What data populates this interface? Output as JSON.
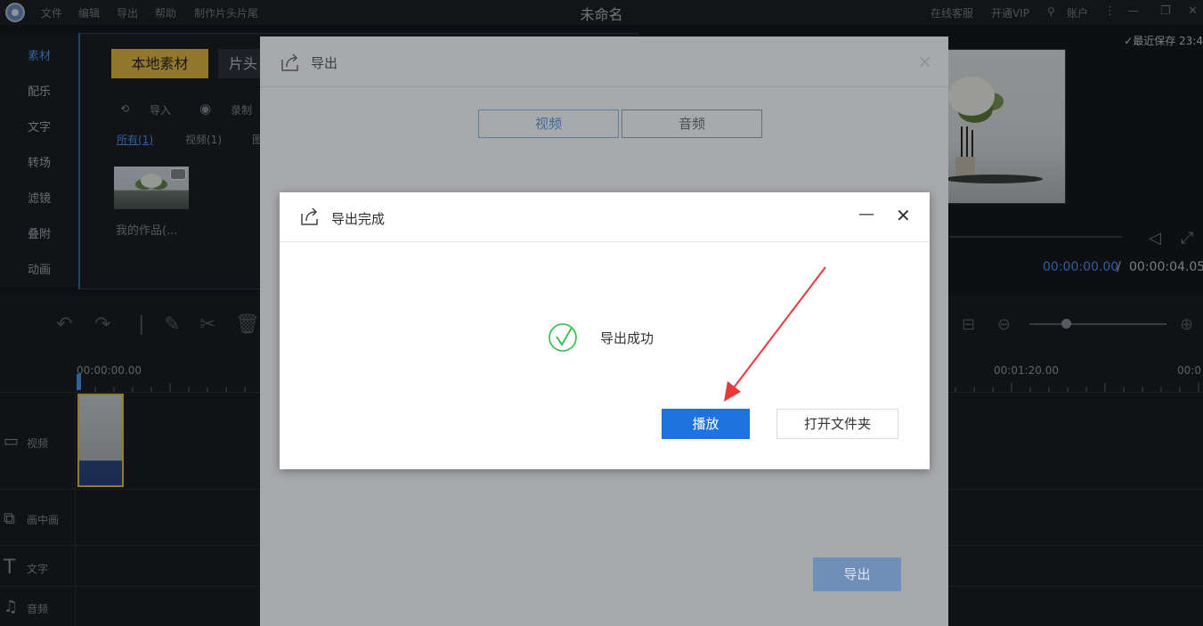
{
  "titlebar": {
    "menu": [
      "文件",
      "编辑",
      "导出",
      "帮助",
      "制作片头片尾"
    ],
    "title": "未命名",
    "right_links": [
      "在线客服",
      "开通VIP",
      "账户"
    ]
  },
  "sidebar": {
    "items": [
      "素材",
      "配乐",
      "文字",
      "转场",
      "滤镜",
      "叠附",
      "动画"
    ],
    "active_index": 0
  },
  "media": {
    "tab_local": "本地素材",
    "tab_clip": "片头",
    "import_label": "导入",
    "record_label": "录制",
    "filter_all": "所有(1)",
    "filter_video": "视频(1)",
    "filter_more": "图",
    "item_name": "我的作品(..."
  },
  "preview": {
    "save_status": "最近保存 23:4",
    "current_time": "00:00:00.00",
    "separator": "/",
    "total_time": "00:00:04.05"
  },
  "timeline": {
    "ruler_labels": [
      "00:00:00.00",
      "00:01:20.00",
      "00:0"
    ],
    "tracks": [
      "视频",
      "画中画",
      "文字",
      "音频"
    ]
  },
  "export_dialog": {
    "title": "导出",
    "close": "×",
    "tab_video": "视频",
    "tab_audio": "音频",
    "export_button": "导出"
  },
  "complete_dialog": {
    "title": "导出完成",
    "minimize": "—",
    "close": "✕",
    "message": "导出成功",
    "play_button": "播放",
    "open_folder_button": "打开文件夹"
  },
  "colors": {
    "accent_blue": "#1f73df",
    "success_green": "#2dbd4a",
    "arrow_red": "#e83a3a",
    "tab_yellow": "#ecc04a"
  }
}
